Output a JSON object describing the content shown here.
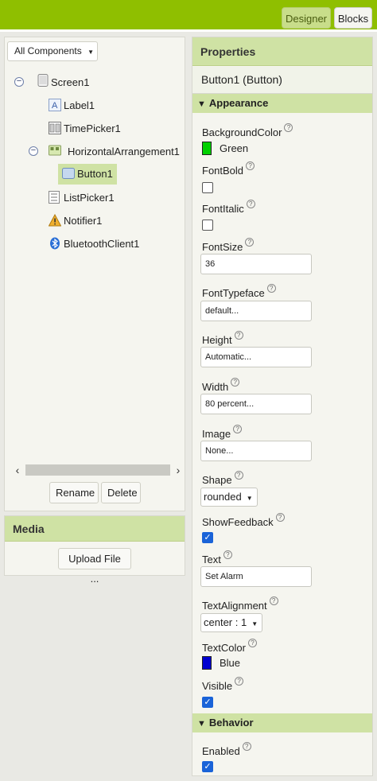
{
  "topbar": {
    "designer_label": "Designer",
    "blocks_label": "Blocks"
  },
  "components": {
    "dropdown_label": "All Components",
    "tree": [
      {
        "label": "Screen1",
        "icon": "screen-icon",
        "toggle": "⊖"
      },
      {
        "label": "Label1",
        "icon": "label-icon"
      },
      {
        "label": "TimePicker1",
        "icon": "timepicker-icon"
      },
      {
        "label": "HorizontalArrangement1",
        "icon": "horizontal-arrangement-icon",
        "toggle": "⊖"
      },
      {
        "label": "Button1",
        "icon": "button-icon",
        "selected": true
      },
      {
        "label": "ListPicker1",
        "icon": "listpicker-icon"
      },
      {
        "label": "Notifier1",
        "icon": "notifier-icon"
      },
      {
        "label": "BluetoothClient1",
        "icon": "bluetooth-icon"
      }
    ],
    "rename_label": "Rename",
    "delete_label": "Delete"
  },
  "media": {
    "title": "Media",
    "upload_label": "Upload File ..."
  },
  "properties": {
    "title": "Properties",
    "component": "Button1 (Button)",
    "appearance_label": "Appearance",
    "behavior_label": "Behavior",
    "background_color": {
      "label": "BackgroundColor",
      "value": "Green",
      "color": "#00d000"
    },
    "font_bold": {
      "label": "FontBold",
      "checked": false
    },
    "font_italic": {
      "label": "FontItalic",
      "checked": false
    },
    "font_size": {
      "label": "FontSize",
      "value": "36"
    },
    "font_typeface": {
      "label": "FontTypeface",
      "value": "default..."
    },
    "height": {
      "label": "Height",
      "value": "Automatic..."
    },
    "width": {
      "label": "Width",
      "value": "80 percent..."
    },
    "image": {
      "label": "Image",
      "value": "None..."
    },
    "shape": {
      "label": "Shape",
      "value": "rounded"
    },
    "show_feedback": {
      "label": "ShowFeedback",
      "checked": true
    },
    "text": {
      "label": "Text",
      "value": "Set Alarm"
    },
    "text_alignment": {
      "label": "TextAlignment",
      "value": "center : 1"
    },
    "text_color": {
      "label": "TextColor",
      "value": "Blue",
      "color": "#0000d0"
    },
    "visible": {
      "label": "Visible",
      "checked": true
    },
    "enabled": {
      "label": "Enabled",
      "checked": true
    }
  },
  "colors": {
    "accent": "#8fbf00",
    "header": "#cfe2a4"
  }
}
